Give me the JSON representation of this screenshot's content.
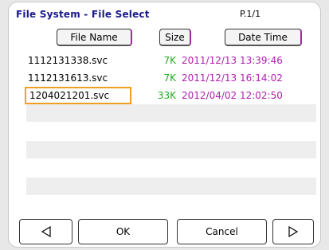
{
  "header": {
    "title": "File System - File Select",
    "page": "P.1/1"
  },
  "columns": {
    "name": "File Name",
    "size": "Size",
    "datetime": "Date Time"
  },
  "files": [
    {
      "name": "1112131338.svc",
      "size": "7K",
      "datetime": "2011/12/13 13:39:46"
    },
    {
      "name": "1112131613.svc",
      "size": "7K",
      "datetime": "2011/12/13 16:14:02"
    },
    {
      "name": "1204021201.svc",
      "size": "33K",
      "datetime": "2012/04/02 12:02:50"
    }
  ],
  "buttons": {
    "ok": "OK",
    "cancel": "Cancel"
  },
  "colors": {
    "title": "#1a1a8c",
    "size": "#22aa22",
    "datetime": "#b020b0",
    "selection": "#f0a020"
  }
}
